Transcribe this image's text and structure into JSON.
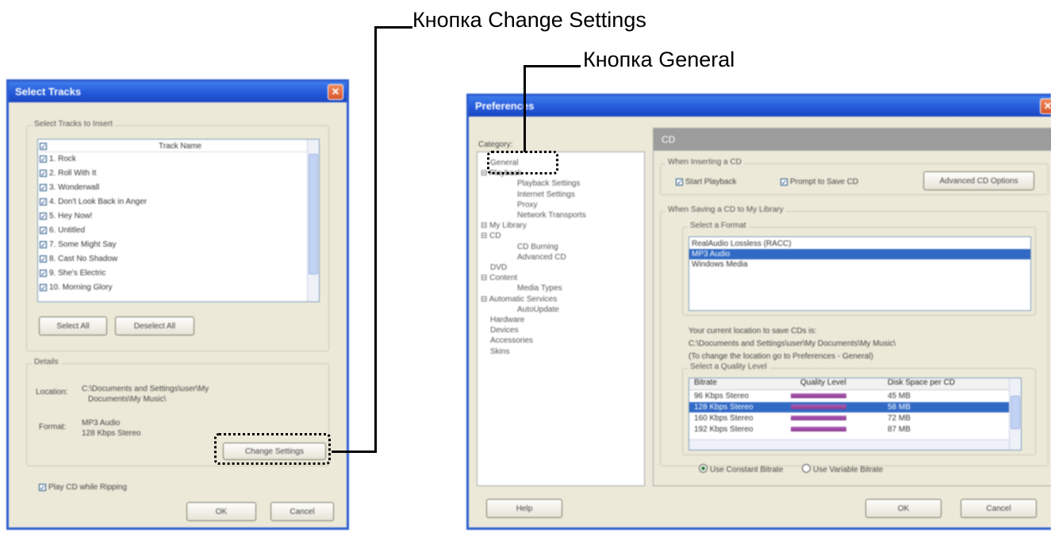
{
  "callouts": {
    "change_settings": "Кнопка Change Settings",
    "general": "Кнопка General"
  },
  "select_tracks_window": {
    "title": "Select Tracks",
    "group_label": "Select Tracks to Insert",
    "column_header": "Track Name",
    "tracks": [
      "1. Rock",
      "2. Roll With It",
      "3. Wonderwall",
      "4. Don't Look Back in Anger",
      "5. Hey Now!",
      "6. Untitled",
      "7. Some Might Say",
      "8. Cast No Shadow",
      "9. She's Electric",
      "10. Morning Glory"
    ],
    "select_all": "Select All",
    "deselect_all": "Deselect All",
    "details_label": "Details",
    "location_label": "Location:",
    "location_value_1": "C:\\Documents and Settings\\user\\My",
    "location_value_2": "Documents\\My Music\\",
    "format_label": "Format:",
    "format_value_1": "MP3 Audio",
    "format_value_2": "128 Kbps Stereo",
    "change_settings": "Change Settings",
    "play_cd": "Play CD while Ripping",
    "ok": "OK",
    "cancel": "Cancel"
  },
  "preferences_window": {
    "title": "Preferences",
    "category_label": "Category:",
    "tree": [
      "General",
      "Playback",
      "Playback Settings",
      "Internet Settings",
      "Proxy",
      "Network Transports",
      "My Library",
      "CD",
      "CD Burning",
      "Advanced CD",
      "DVD",
      "Content",
      "Media Types",
      "Automatic Services",
      "AutoUpdate",
      "Hardware",
      "Devices",
      "Accessories",
      "Skins"
    ],
    "section_title": "CD",
    "when_inserting": "When Inserting a CD",
    "start_playback": "Start Playback",
    "prompt_save": "Prompt to Save CD",
    "advanced_cd": "Advanced CD Options",
    "when_saving": "When Saving a CD to My Library",
    "select_format": "Select a Format",
    "formats": [
      "RealAudio Lossless (RACC)",
      "MP3 Audio",
      "Windows Media"
    ],
    "save_location_1": "Your current location to save CDs is:",
    "save_location_2": "C:\\Documents and Settings\\user\\My Documents\\My Music\\",
    "save_location_3": "(To change the location go to Preferences - General)",
    "select_quality": "Select a Quality Level",
    "quality_columns": [
      "Bitrate",
      "Quality Level",
      "Disk Space per CD"
    ],
    "quality_rows": [
      {
        "bitrate": "96 Kbps Stereo",
        "size": "45 MB"
      },
      {
        "bitrate": "128 Kbps Stereo",
        "size": "58 MB"
      },
      {
        "bitrate": "160 Kbps Stereo",
        "size": "72 MB"
      },
      {
        "bitrate": "192 Kbps Stereo",
        "size": "87 MB"
      }
    ],
    "constant": "Use Constant Bitrate",
    "variable": "Use Variable Bitrate",
    "help": "Help",
    "ok": "OK",
    "cancel": "Cancel"
  }
}
